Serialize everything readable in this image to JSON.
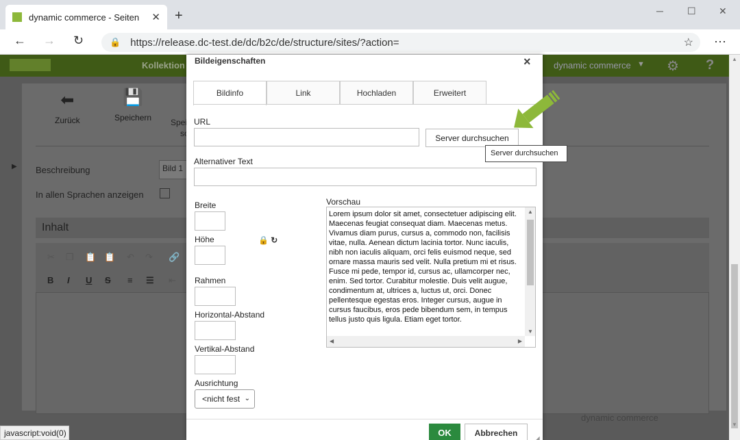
{
  "browser": {
    "tab_title": "dynamic commerce - Seiten",
    "url": "https://release.dc-test.de/dc/b2c/de/structure/sites/?action=",
    "status_text": "javascript:void(0)"
  },
  "app": {
    "header_nav": "Kollektion",
    "header_right": "dynamic commerce",
    "toolbar": {
      "back_label": "Zurück",
      "save_label": "Speichern",
      "save_close_label_partial": "Spei",
      "save_close_label_partial2": "sc"
    },
    "fields": {
      "description_label": "Beschreibung",
      "description_value": "Bild 1",
      "all_languages_label": "In allen Sprachen anzeigen",
      "content_header": "Inhalt"
    },
    "footer_brand": "dynamic commerce"
  },
  "dialog": {
    "title": "Bildeigenschaften",
    "tabs": [
      "Bildinfo",
      "Link",
      "Hochladen",
      "Erweitert"
    ],
    "url_label": "URL",
    "url_value": "",
    "browse_button": "Server durchsuchen",
    "tooltip": "Server durchsuchen",
    "alt_label": "Alternativer Text",
    "alt_value": "",
    "width_label": "Breite",
    "height_label": "Höhe",
    "border_label": "Rahmen",
    "hspace_label": "Horizontal-Abstand",
    "vspace_label": "Vertikal-Abstand",
    "align_label": "Ausrichtung",
    "align_value": "<nicht fest",
    "preview_label": "Vorschau",
    "preview_text": "Lorem ipsum dolor sit amet, consectetuer adipiscing elit. Maecenas feugiat consequat diam. Maecenas metus. Vivamus diam purus, cursus a, commodo non, facilisis vitae, nulla. Aenean dictum lacinia tortor. Nunc iaculis, nibh non iaculis aliquam, orci felis euismod neque, sed ornare massa mauris sed velit. Nulla pretium mi et risus. Fusce mi pede, tempor id, cursus ac, ullamcorper nec, enim. Sed tortor. Curabitur molestie. Duis velit augue, condimentum at, ultrices a, luctus ut, orci. Donec pellentesque egestas eros. Integer cursus, augue in cursus faucibus, eros pede bibendum sem, in tempus tellus justo quis ligula. Etiam eget tortor.",
    "ok_button": "OK",
    "cancel_button": "Abbrechen"
  },
  "colors": {
    "ok_green": "#2b8a3e",
    "arrow_green": "#8db83a",
    "app_header": "#3f5a16"
  }
}
